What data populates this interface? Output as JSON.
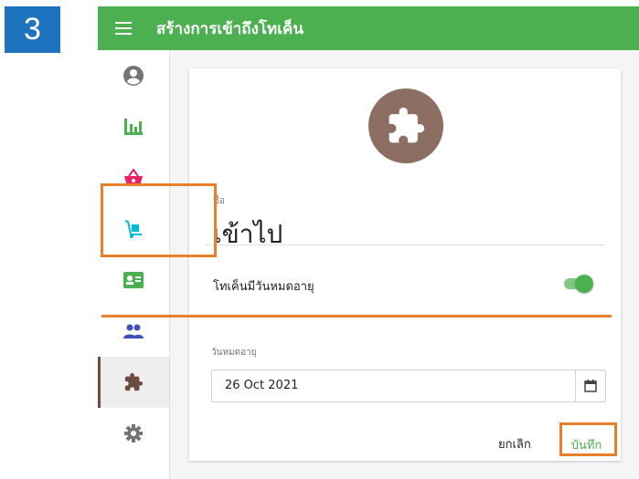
{
  "step_badge": "3",
  "appbar": {
    "title": "สร้างการเข้าถึงโทเค็น"
  },
  "sidebar": {
    "items": [
      {
        "icon": "account-circle-icon",
        "color": "#757575"
      },
      {
        "icon": "bar-chart-icon",
        "color": "#4caf50"
      },
      {
        "icon": "shopping-basket-icon",
        "color": "#e91e63"
      },
      {
        "icon": "dolly-icon",
        "color": "#00bcd4"
      },
      {
        "icon": "contact-card-icon",
        "color": "#4caf50"
      },
      {
        "icon": "people-icon",
        "color": "#3f51b5"
      },
      {
        "icon": "puzzle-icon",
        "color": "#6d4c41",
        "active": true
      },
      {
        "icon": "gear-icon",
        "color": "#757575"
      }
    ]
  },
  "form": {
    "name_label": "ชื่อ",
    "name_value": "เข้าไป",
    "expiry_toggle_label": "โทเค็นมีวันหมดอายุ",
    "expiry_toggle_on": true,
    "expiry_date_label": "วันหมดอายุ",
    "expiry_date_value": "26 Oct 2021",
    "cancel_label": "ยกเลิก",
    "save_label": "บันทึก"
  },
  "colors": {
    "appbar": "#4caf50",
    "avatar": "#8d6e63",
    "highlight": "#e87f2c",
    "badge": "#1e73be"
  }
}
